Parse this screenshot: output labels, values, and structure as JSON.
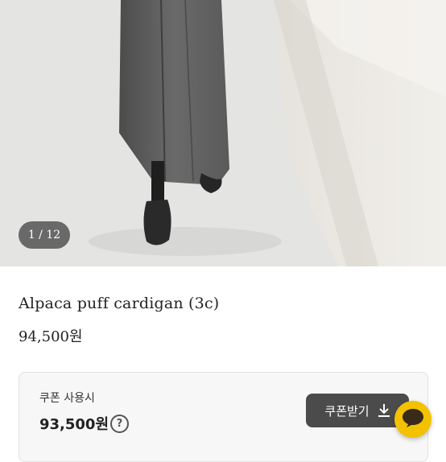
{
  "gallery": {
    "counter": "1 / 12"
  },
  "product": {
    "title": "Alpaca puff cardigan (3c)",
    "price": "94,500원"
  },
  "coupon": {
    "label": "쿠폰 사용시",
    "discounted_price": "93,500원",
    "help_symbol": "?",
    "button_label": "쿠폰받기",
    "button_icon": "download-icon"
  },
  "chat": {
    "icon": "chat-bubble-icon",
    "color": "#f2c200"
  }
}
